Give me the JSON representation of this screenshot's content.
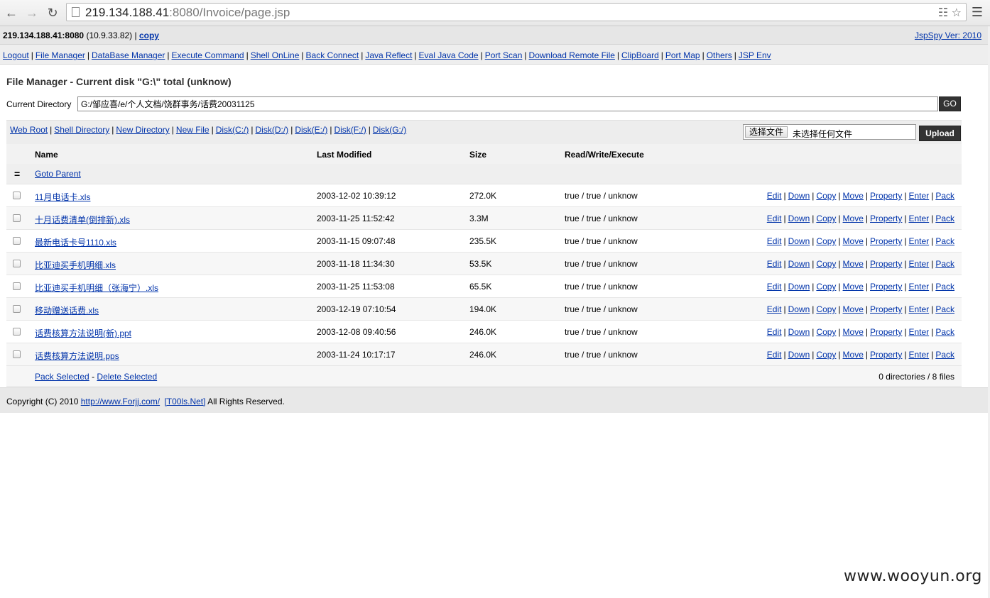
{
  "browser": {
    "url_host": "219.134.188.41",
    "url_rest": ":8080/Invoice/page.jsp",
    "back_icon": "back-arrow-icon",
    "forward_icon": "forward-arrow-icon",
    "reload_icon": "reload-icon"
  },
  "infobar": {
    "host": "219.134.188.41:8080",
    "local_ip": "(10.9.33.82)",
    "copy_label": "copy",
    "version": "JspSpy Ver: 2010"
  },
  "menu": [
    "Logout",
    "File Manager",
    "DataBase Manager",
    "Execute Command",
    "Shell OnLine",
    "Back Connect",
    "Java Reflect",
    "Eval Java Code",
    "Port Scan",
    "Download Remote File",
    "ClipBoard",
    "Port Map",
    "Others",
    "JSP Env"
  ],
  "page": {
    "title": "File Manager - Current disk \"G:\\\" total (unknow)",
    "current_dir_label": "Current Directory",
    "current_dir_value": "G:/邹应喜/e/个人文档/饶群事务/话费20031125",
    "go_label": "GO"
  },
  "toolbar": {
    "links": [
      "Web Root",
      "Shell Directory",
      "New Directory",
      "New File",
      "Disk(C:/)",
      "Disk(D:/)",
      "Disk(E:/)",
      "Disk(F:/)",
      "Disk(G:/)"
    ],
    "choose_file_label": "选择文件",
    "no_file_label": "未选择任何文件",
    "upload_label": "Upload"
  },
  "table": {
    "headers": {
      "name": "Name",
      "modified": "Last Modified",
      "size": "Size",
      "perm": "Read/Write/Execute"
    },
    "parent_icon": "=",
    "parent_label": "Goto Parent",
    "actions": [
      "Edit",
      "Down",
      "Copy",
      "Move",
      "Property",
      "Enter",
      "Pack"
    ],
    "rows": [
      {
        "name": "11月电话卡.xls",
        "modified": "2003-12-02 10:39:12",
        "size": "272.0K",
        "perm": "true / true / unknow"
      },
      {
        "name": "十月话费清单(倒排新).xls",
        "modified": "2003-11-25 11:52:42",
        "size": "3.3M",
        "perm": "true / true / unknow"
      },
      {
        "name": "最新电话卡号1110.xls",
        "modified": "2003-11-15 09:07:48",
        "size": "235.5K",
        "perm": "true / true / unknow"
      },
      {
        "name": "比亚迪买手机明细.xls",
        "modified": "2003-11-18 11:34:30",
        "size": "53.5K",
        "perm": "true / true / unknow"
      },
      {
        "name": "比亚迪买手机明细（张海宁）.xls",
        "modified": "2003-11-25 11:53:08",
        "size": "65.5K",
        "perm": "true / true / unknow"
      },
      {
        "name": "移动赠送话费.xls",
        "modified": "2003-12-19 07:10:54",
        "size": "194.0K",
        "perm": "true / true / unknow"
      },
      {
        "name": "话费核算方法说明(新).ppt",
        "modified": "2003-12-08 09:40:56",
        "size": "246.0K",
        "perm": "true / true / unknow"
      },
      {
        "name": "话费核算方法说明.pps",
        "modified": "2003-11-24 10:17:17",
        "size": "246.0K",
        "perm": "true / true / unknow"
      }
    ],
    "pack_selected": "Pack Selected",
    "dash": "-",
    "delete_selected": "Delete Selected",
    "summary": "0 directories / 8 files"
  },
  "footer": {
    "prefix": "Copyright (C) 2010",
    "link1": "http://www.Forjj.com/",
    "link2": "[T00ls.Net]",
    "suffix": "All Rights Reserved."
  },
  "watermark": "www.wooyun.org"
}
